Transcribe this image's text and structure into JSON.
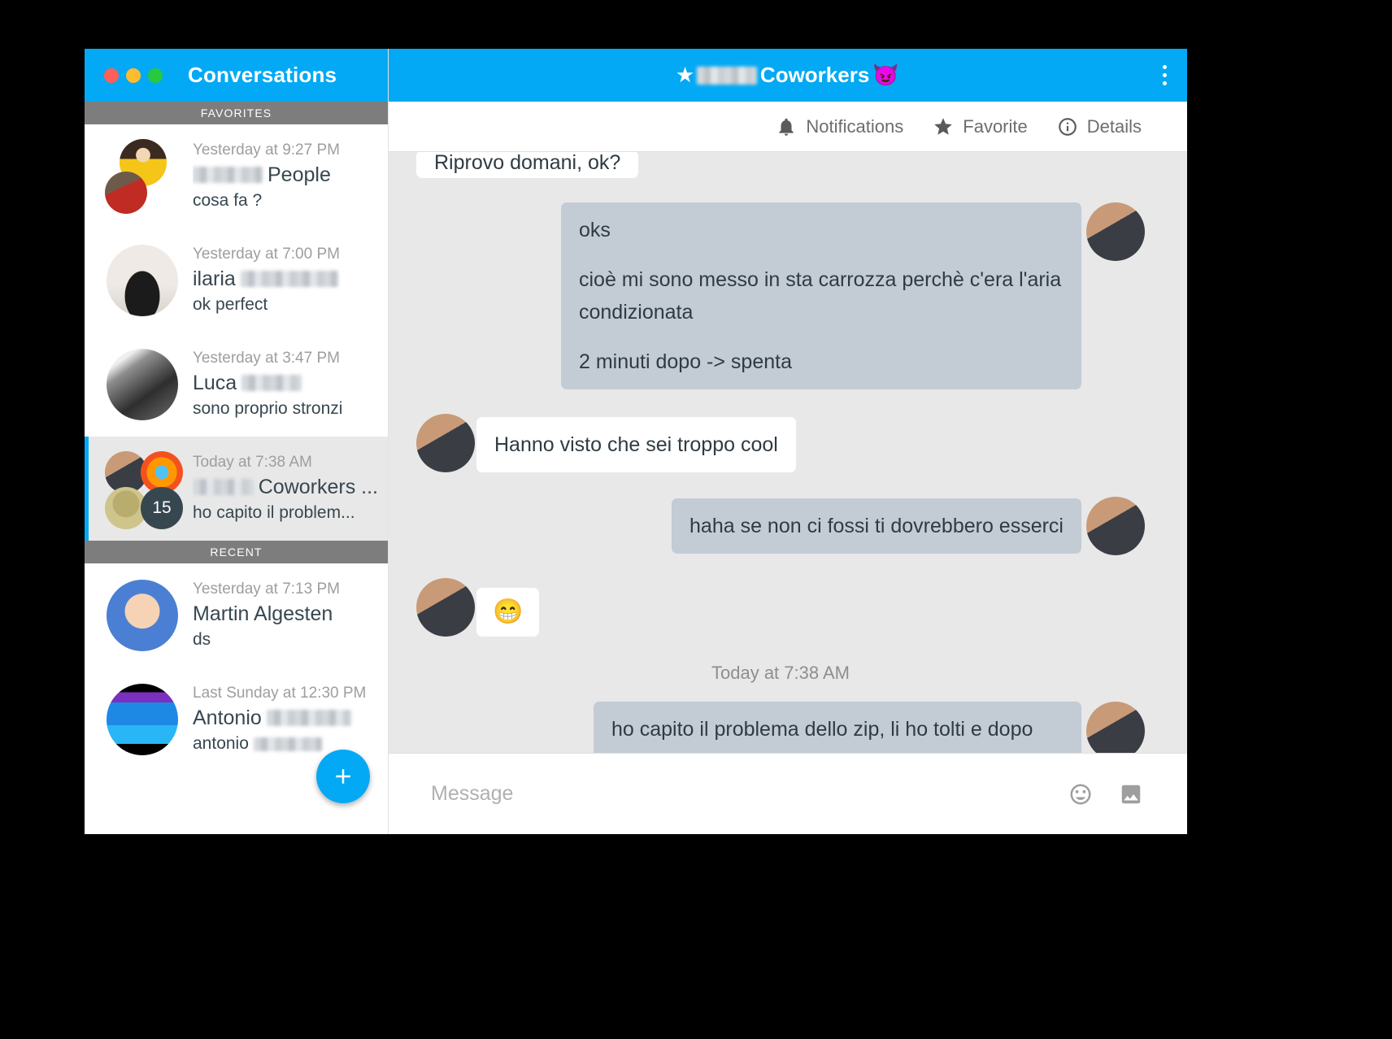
{
  "window": {
    "traffic_lights": [
      "close",
      "minimize",
      "zoom"
    ]
  },
  "sidebar": {
    "title": "Conversations",
    "sections": [
      {
        "header": "FAVORITES",
        "items": [
          {
            "time": "Yesterday at 9:27 PM",
            "name_redacted": true,
            "name": "People",
            "preview": "cosa fa ?",
            "selected": false,
            "avatar_style": "triple",
            "unread_count": null
          },
          {
            "time": "Yesterday at 7:00 PM",
            "name": "ilaria",
            "name_suffix_redacted": true,
            "preview": "ok perfect",
            "selected": false,
            "avatar_style": "single",
            "unread_count": null
          },
          {
            "time": "Yesterday at 3:47 PM",
            "name": "Luca",
            "name_suffix_redacted": true,
            "preview": "sono proprio stronzi",
            "selected": false,
            "avatar_style": "single",
            "unread_count": null
          },
          {
            "time": "Today at 7:38 AM",
            "name_redacted": true,
            "name": "Coworkers ...",
            "preview": "ho capito il problem...",
            "selected": true,
            "avatar_style": "quad",
            "unread_count": "15"
          }
        ]
      },
      {
        "header": "RECENT",
        "items": [
          {
            "time": "Yesterday at 7:13 PM",
            "name": "Martin Algesten",
            "preview": "ds",
            "selected": false,
            "avatar_style": "single",
            "unread_count": null
          },
          {
            "time": "Last Sunday at 12:30 PM",
            "name": "Antonio",
            "name_suffix_redacted": true,
            "preview": "antonio",
            "preview_suffix_redacted": true,
            "selected": false,
            "avatar_style": "single",
            "unread_count": null
          }
        ]
      }
    ],
    "new_conversation_label": "+"
  },
  "chat": {
    "title_star": "★",
    "title_redacted": true,
    "title": "Coworkers",
    "title_emoji": "😈",
    "kebab_label": "More options",
    "toolbar": [
      {
        "id": "notifications",
        "label": "Notifications",
        "icon": "bell-icon"
      },
      {
        "id": "favorite",
        "label": "Favorite",
        "icon": "star-icon"
      },
      {
        "id": "details",
        "label": "Details",
        "icon": "info-icon"
      }
    ],
    "messages": [
      {
        "direction": "incoming",
        "clipped": true,
        "show_avatar": false,
        "lines": [
          "Riprovo domani, ok?"
        ]
      },
      {
        "direction": "outgoing",
        "show_avatar": true,
        "avatar": "ph-man-rock-dark",
        "lines": [
          "oks",
          "cioè mi sono messo in sta carrozza perchè c'era l'aria condizionata",
          "2 minuti dopo -> spenta"
        ]
      },
      {
        "direction": "incoming",
        "show_avatar": true,
        "avatar": "ph-man-rock",
        "lines": [
          "Hanno visto che sei troppo cool"
        ]
      },
      {
        "direction": "outgoing",
        "show_avatar": true,
        "avatar": "ph-man-rock-dark",
        "lines": [
          "haha se non ci fossi ti dovrebbero esserci"
        ]
      },
      {
        "direction": "incoming",
        "show_avatar": true,
        "avatar": "ph-man-rock",
        "emoji_only": true,
        "lines": [
          "😁"
        ]
      }
    ],
    "time_divider": "Today at 7:38 AM",
    "last_message": {
      "direction": "outgoing",
      "show_avatar": true,
      "lines": [
        "ho capito il problema dello zip, li ho tolti e dopo rifaccio upload"
      ]
    }
  },
  "composer": {
    "placeholder": "Message",
    "value": "",
    "emoji_button": "emoji-icon",
    "image_button": "image-icon"
  },
  "colors": {
    "accent": "#03a9f4",
    "section_header_bg": "#7d7d7d",
    "outgoing_bubble": "#c3ccd4",
    "incoming_bubble": "#ffffff",
    "chat_bg": "#e8e8e8",
    "selected_item_bg": "#e8e8e8",
    "badge_bg": "#37474f"
  }
}
